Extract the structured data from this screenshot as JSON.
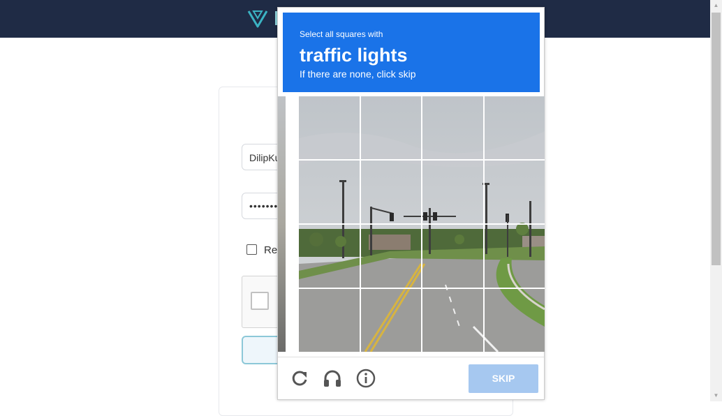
{
  "login": {
    "username_value": "DilipKu",
    "password_value": "•••••••",
    "remember_label": "Re"
  },
  "captcha": {
    "instruction_line1": "Select all squares with",
    "instruction_target": "traffic lights",
    "instruction_line3": "If there are none, click skip",
    "grid": {
      "rows": 4,
      "cols": 4
    },
    "skip_label": "SKIP",
    "icons": [
      "reload-icon",
      "audio-icon",
      "info-icon"
    ],
    "accent_color": "#1a73e8",
    "skip_color": "#a6c8f0"
  },
  "header": {
    "background_color": "#1f2b45",
    "logo_icon": "v-logo-icon"
  }
}
